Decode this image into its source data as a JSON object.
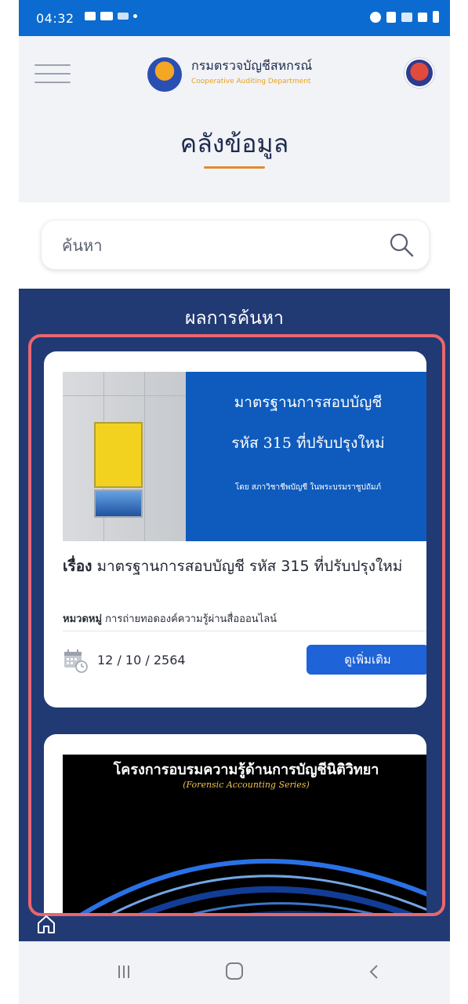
{
  "status_bar": {
    "time": "04:32"
  },
  "header": {
    "brand_th": "กรมตรวจบัญชีสหกรณ์",
    "brand_en": "Cooperative Auditing Department",
    "page_title": "คลังข้อมูล"
  },
  "search": {
    "placeholder": "ค้นหา"
  },
  "results": {
    "title": "ผลการค้นหา",
    "items": [
      {
        "image_text_line1": "มาตรฐานการสอบบัญชี",
        "image_text_line2": "รหัส 315 ที่ปรับปรุงใหม่",
        "image_text_line3": "โดย สภาวิชาชีพบัญชี ในพระบรมราชูปถัมภ์",
        "title_label": "เรื่อง",
        "title": "มาตรฐานการสอบบัญชี รหัส 315 ที่ปรับปรุงใหม่",
        "category_label": "หมวดหมู่",
        "category": "การถ่ายทอดองค์ความรู้ผ่านสื่อออนไลน์",
        "date": "12 / 10 / 2564",
        "more_label": "ดูเพิ่มเติม"
      },
      {
        "image_title": "โครงการอบรมความรู้ด้านการบัญชีนิติวิทยา",
        "image_subtitle": "(Forensic Accounting Series)"
      }
    ]
  },
  "colors": {
    "status_bar": "#0b6bd0",
    "results_bg": "#213a74",
    "highlight_border": "#e9666f",
    "button": "#1f63d8",
    "accent_underline": "#e38a2e"
  }
}
